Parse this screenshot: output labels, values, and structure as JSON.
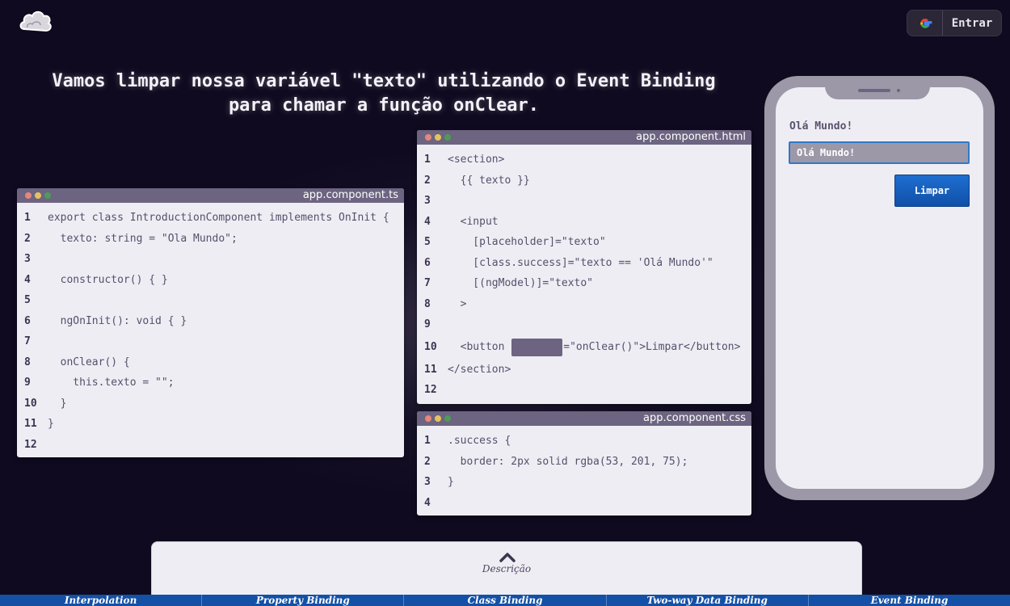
{
  "header": {
    "login_label": "Entrar",
    "logo_icon": "cloud-icon",
    "google_icon": "google-icon"
  },
  "headline": {
    "line1": "Vamos limpar nossa variável \"texto\" utilizando o Event Binding",
    "line2": "para chamar a função onClear."
  },
  "ts_window": {
    "filename": "app.component.ts",
    "lines": [
      "export class IntroductionComponent implements OnInit {",
      "  texto: string = \"Ola Mundo\";",
      "",
      "  constructor() { }",
      "",
      "  ngOnInit(): void { }",
      "",
      "  onClear() {",
      "    this.texto = \"\";",
      "  }",
      "}",
      ""
    ]
  },
  "html_window": {
    "filename": "app.component.html",
    "lines": [
      "<section>",
      "  {{ texto }}",
      "",
      "  <input",
      "    [placeholder]=\"texto\"",
      "    [class.success]=\"texto == 'Olá Mundo'\"",
      "    [(ngModel)]=\"texto\"",
      "  >",
      "",
      "  <button ",
      "</section>",
      ""
    ],
    "line10_suffix": "=\"onClear()\">Limpar</button>"
  },
  "css_window": {
    "filename": "app.component.css",
    "lines": [
      ".success {",
      "  border: 2px solid rgba(53, 201, 75);",
      "}",
      ""
    ]
  },
  "phone": {
    "output_text": "Olá Mundo!",
    "input_value": "Olá Mundo!",
    "button_label": "Limpar"
  },
  "description": {
    "label": "Descrição"
  },
  "bottom_nav": {
    "tabs": [
      "Interpolation",
      "Property Binding",
      "Class Binding",
      "Two-way Data Binding",
      "Event Binding"
    ]
  },
  "colors": {
    "background": "#0f0a1f",
    "window_titlebar": "#6c6480",
    "code_bg": "#efedf4",
    "accent_blue": "#1350a6"
  }
}
